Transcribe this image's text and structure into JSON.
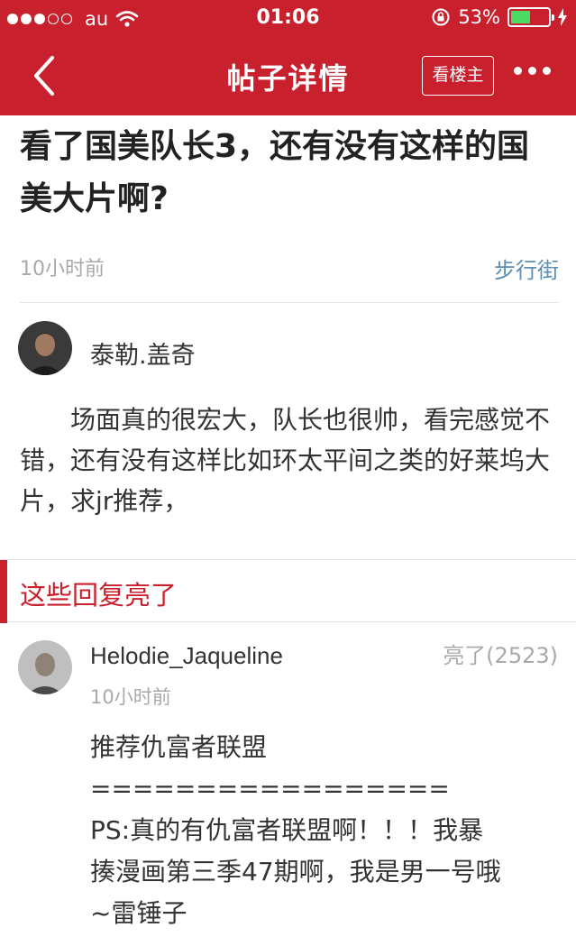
{
  "status_bar": {
    "carrier": "au",
    "time": "01:06",
    "battery": "53%",
    "battery_level": 0.53
  },
  "nav": {
    "title": "帖子详情",
    "view_op_label": "看楼主"
  },
  "post": {
    "title": "看了国美队长3，还有没有这样的国美大片啊?",
    "time": "10小时前",
    "board": "步行街",
    "author": "泰勒.盖奇",
    "body": "场面真的很宏大，队长也很帅，看完感觉不错，还有没有这样比如环太平间之类的好莱坞大片，求jr推荐，"
  },
  "replies_section": {
    "title": "这些回复亮了"
  },
  "reply": {
    "author": "Helodie_Jaqueline",
    "light_count": "亮了(2523)",
    "time": "10小时前",
    "lines": [
      "推荐仇富者联盟",
      "=================",
      "PS:真的有仇富者联盟啊！！！我暴",
      "揍漫画第三季47期啊，我是男一号哦",
      "~雷锤子"
    ]
  },
  "colors": {
    "brand_red": "#c9202e",
    "board_link": "#5a8fb5",
    "muted_text": "#a9a9a9"
  }
}
